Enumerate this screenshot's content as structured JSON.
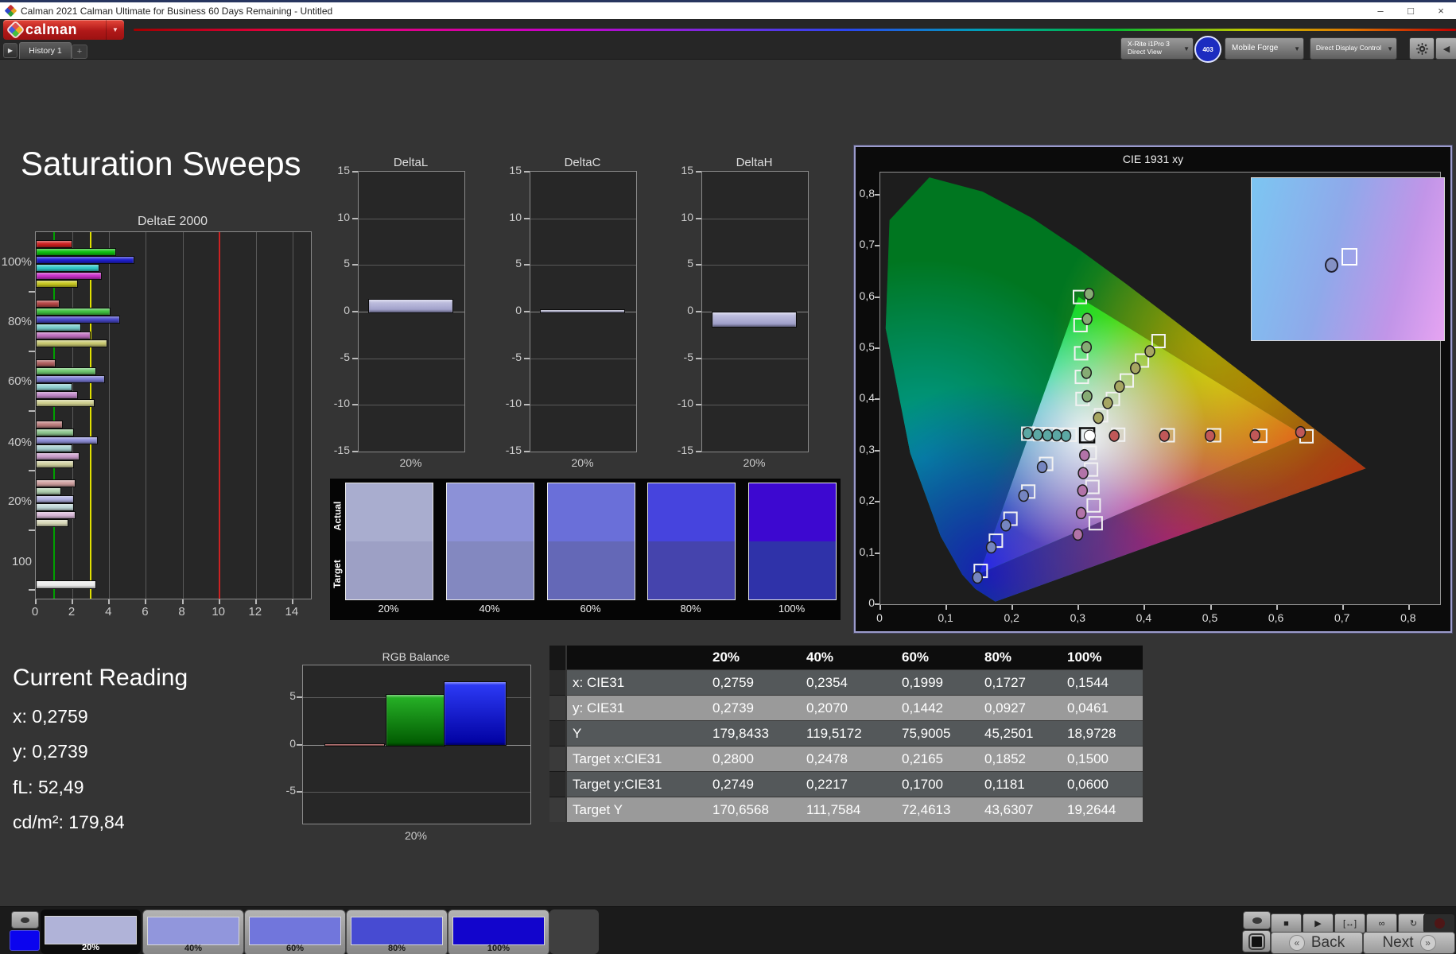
{
  "window": {
    "title": "Calman 2021 Calman Ultimate for Business 60 Days Remaining  - Untitled",
    "minimize": "–",
    "maximize": "□",
    "close": "×"
  },
  "brand": {
    "name": "calman",
    "dropdown_arrow": "▼"
  },
  "nav": {
    "history_tab": "History 1",
    "add_tab": "+",
    "nav_arrow": "▶"
  },
  "devices": {
    "meter": {
      "line1": "X-Rite i1Pro 3",
      "line2": "Direct View",
      "accent": "#2fd42f",
      "badge": "403"
    },
    "source": {
      "label": "Mobile Forge",
      "accent": "#2fd42f"
    },
    "display": {
      "label": "Direct Display Control",
      "accent": "#e6df1a"
    }
  },
  "page_title": "Saturation Sweeps",
  "chart_data": {
    "deltae2000": {
      "type": "bar",
      "title": "DeltaE 2000",
      "orientation": "horizontal",
      "xlim": [
        0,
        15
      ],
      "x_ticks": [
        0,
        2,
        4,
        6,
        8,
        10,
        12,
        14
      ],
      "ref_lines": [
        {
          "value": 1,
          "color": "#00a000"
        },
        {
          "value": 3,
          "color": "#e0e000"
        },
        {
          "value": 10,
          "color": "#cc2222"
        }
      ],
      "series_order": [
        "red",
        "green",
        "blue",
        "cyan",
        "magenta",
        "yellow"
      ],
      "groups": [
        {
          "label": "100%",
          "values": [
            1.9,
            4.3,
            5.3,
            3.4,
            3.5,
            2.2
          ],
          "colors": [
            "#cc2020",
            "#10c010",
            "#2020d0",
            "#30c8c8",
            "#c830c8",
            "#c8c820"
          ]
        },
        {
          "label": "80%",
          "values": [
            1.2,
            4.0,
            4.5,
            2.4,
            2.9,
            3.8
          ],
          "colors": [
            "#b44444",
            "#40c040",
            "#4848c8",
            "#78cccc",
            "#c070c0",
            "#c8c870"
          ]
        },
        {
          "label": "60%",
          "values": [
            1.0,
            3.2,
            3.7,
            1.9,
            2.2,
            3.1
          ],
          "colors": [
            "#b06060",
            "#70c870",
            "#7878d0",
            "#90d0d0",
            "#c088c8",
            "#d0d090"
          ]
        },
        {
          "label": "40%",
          "values": [
            1.4,
            2.0,
            3.3,
            1.9,
            2.3,
            2.0
          ],
          "colors": [
            "#c08080",
            "#90c890",
            "#9090d8",
            "#a8d0d0",
            "#cc9fcc",
            "#d0d0a0"
          ]
        },
        {
          "label": "20%",
          "values": [
            2.1,
            1.3,
            2.0,
            2.0,
            2.1,
            1.7
          ],
          "colors": [
            "#d0a0a0",
            "#b0d0b0",
            "#b0b0e0",
            "#c0d8d8",
            "#d8b8d8",
            "#d8d8b8"
          ]
        }
      ],
      "white_bar": {
        "label": "100",
        "value": 3.2,
        "color": "#ededed"
      }
    },
    "delta_charts": {
      "type": "bar",
      "ylim": [
        -15,
        15
      ],
      "y_ticks": [
        15,
        10,
        5,
        0,
        -5,
        -10,
        -15
      ],
      "xlabel": "20%",
      "bar_color_top": "#c9c9e6",
      "bar_color_bottom": "#9595c2",
      "items": [
        {
          "title": "DeltaL",
          "value": 1.4
        },
        {
          "title": "DeltaC",
          "value": 0.25
        },
        {
          "title": "DeltaH",
          "value": -1.5
        }
      ]
    },
    "swatches": {
      "row_labels": [
        "Actual",
        "Target"
      ],
      "items": [
        {
          "label": "20%",
          "actual": "#a9adcf",
          "target": "#9da0c5"
        },
        {
          "label": "40%",
          "actual": "#8c91d7",
          "target": "#8388c0"
        },
        {
          "label": "60%",
          "actual": "#6a6fd9",
          "target": "#6468b7"
        },
        {
          "label": "80%",
          "actual": "#4644de",
          "target": "#4544ad"
        },
        {
          "label": "100%",
          "actual": "#3d08d0",
          "target": "#2f32a9"
        }
      ]
    },
    "cie": {
      "type": "scatter",
      "title": "CIE 1931 xy",
      "xlim": [
        0,
        0.845
      ],
      "ylim": [
        0,
        0.843
      ],
      "x_ticks": [
        "0",
        "0,1",
        "0,2",
        "0,3",
        "0,4",
        "0,5",
        "0,6",
        "0,7",
        "0,8"
      ],
      "y_ticks": [
        "0",
        "0,1",
        "0,2",
        "0,3",
        "0,4",
        "0,5",
        "0,6",
        "0,7",
        "0,8"
      ],
      "white_point": {
        "target": [
          0.313,
          0.33
        ],
        "measured": [
          0.317,
          0.329
        ]
      },
      "sweeps": [
        {
          "name": "red",
          "dot": "#c05858",
          "targets": [
            [
              0.36,
              0.331
            ],
            [
              0.435,
              0.33
            ],
            [
              0.505,
              0.33
            ],
            [
              0.575,
              0.329
            ],
            [
              0.645,
              0.328
            ]
          ],
          "measured": [
            [
              0.354,
              0.329
            ],
            [
              0.43,
              0.329
            ],
            [
              0.499,
              0.329
            ],
            [
              0.567,
              0.33
            ],
            [
              0.636,
              0.336
            ]
          ]
        },
        {
          "name": "green",
          "dot": "#86ac74",
          "targets": [
            [
              0.306,
              0.401
            ],
            [
              0.305,
              0.444
            ],
            [
              0.304,
              0.49
            ],
            [
              0.303,
              0.545
            ],
            [
              0.302,
              0.6
            ]
          ],
          "measured": [
            [
              0.313,
              0.406
            ],
            [
              0.312,
              0.452
            ],
            [
              0.312,
              0.502
            ],
            [
              0.313,
              0.557
            ],
            [
              0.316,
              0.606
            ]
          ]
        },
        {
          "name": "blue",
          "dot": "#7585c0",
          "targets": [
            [
              0.251,
              0.274
            ],
            [
              0.224,
              0.22
            ],
            [
              0.197,
              0.167
            ],
            [
              0.175,
              0.124
            ],
            [
              0.152,
              0.065
            ]
          ],
          "measured": [
            [
              0.245,
              0.268
            ],
            [
              0.217,
              0.212
            ],
            [
              0.19,
              0.154
            ],
            [
              0.168,
              0.111
            ],
            [
              0.147,
              0.052
            ]
          ]
        },
        {
          "name": "cyan",
          "dot": "#5ca8a4",
          "targets": [
            [
              0.287,
              0.331
            ],
            [
              0.272,
              0.331
            ],
            [
              0.257,
              0.332
            ],
            [
              0.242,
              0.332
            ],
            [
              0.224,
              0.333
            ]
          ],
          "measured": [
            [
              0.281,
              0.329
            ],
            [
              0.267,
              0.33
            ],
            [
              0.253,
              0.33
            ],
            [
              0.238,
              0.331
            ],
            [
              0.223,
              0.334
            ]
          ]
        },
        {
          "name": "magenta",
          "dot": "#b273a8",
          "targets": [
            [
              0.317,
              0.296
            ],
            [
              0.319,
              0.263
            ],
            [
              0.321,
              0.229
            ],
            [
              0.323,
              0.193
            ],
            [
              0.326,
              0.158
            ]
          ],
          "measured": [
            [
              0.309,
              0.291
            ],
            [
              0.307,
              0.256
            ],
            [
              0.306,
              0.222
            ],
            [
              0.304,
              0.178
            ],
            [
              0.299,
              0.136
            ]
          ]
        },
        {
          "name": "yellow",
          "dot": "#a6a662",
          "targets": [
            [
              0.334,
              0.369
            ],
            [
              0.352,
              0.401
            ],
            [
              0.373,
              0.437
            ],
            [
              0.396,
              0.476
            ],
            [
              0.421,
              0.514
            ]
          ],
          "measured": [
            [
              0.33,
              0.364
            ],
            [
              0.344,
              0.393
            ],
            [
              0.362,
              0.425
            ],
            [
              0.386,
              0.461
            ],
            [
              0.408,
              0.494
            ]
          ]
        }
      ]
    },
    "rgb_balance": {
      "type": "bar",
      "title": "RGB Balance",
      "xlabel": "20%",
      "ylim": [
        -8.3,
        8.3
      ],
      "y_ticks": [
        5,
        0,
        -5
      ],
      "series": [
        {
          "name": "red",
          "value": 0.1,
          "color_top": "#b83030",
          "color_bottom": "#701010"
        },
        {
          "name": "green",
          "value": 5.3,
          "color_top": "#28b428",
          "color_bottom": "#005800"
        },
        {
          "name": "blue",
          "value": 6.6,
          "color_top": "#2e3cf8",
          "color_bottom": "#0000a0"
        }
      ]
    },
    "table": {
      "type": "table",
      "columns": [
        "",
        "20%",
        "40%",
        "60%",
        "80%",
        "100%"
      ],
      "rows": [
        {
          "label": "x: CIE31",
          "values": [
            "0,2759",
            "0,2354",
            "0,1999",
            "0,1727",
            "0,1544"
          ]
        },
        {
          "label": "y: CIE31",
          "values": [
            "0,2739",
            "0,2070",
            "0,1442",
            "0,0927",
            "0,0461"
          ]
        },
        {
          "label": "Y",
          "values": [
            "179,8433",
            "119,5172",
            "75,9005",
            "45,2501",
            "18,9728"
          ]
        },
        {
          "label": "Target x:CIE31",
          "values": [
            "0,2800",
            "0,2478",
            "0,2165",
            "0,1852",
            "0,1500"
          ]
        },
        {
          "label": "Target y:CIE31",
          "values": [
            "0,2749",
            "0,2217",
            "0,1700",
            "0,1181",
            "0,0600"
          ]
        },
        {
          "label": "Target Y",
          "values": [
            "170,6568",
            "111,7584",
            "72,4613",
            "43,6307",
            "19,2644"
          ]
        }
      ]
    },
    "current_reading": {
      "title": "Current Reading",
      "lines": [
        {
          "label": "x",
          "value": "0,2759"
        },
        {
          "label": "y",
          "value": "0,2739"
        },
        {
          "label": "fL",
          "value": "52,49"
        },
        {
          "label": "cd/m²",
          "value": "179,84"
        }
      ]
    }
  },
  "bottom": {
    "mini_swatch_color": "#0b04ee",
    "patches": [
      {
        "label": "20%",
        "color": "#b0b3d8",
        "selected": true
      },
      {
        "label": "40%",
        "color": "#9196dc",
        "selected": false
      },
      {
        "label": "60%",
        "color": "#7176dc",
        "selected": false
      },
      {
        "label": "80%",
        "color": "#474bd2",
        "selected": false
      },
      {
        "label": "100%",
        "color": "#1205cc",
        "selected": false
      }
    ],
    "transport": [
      {
        "name": "stop-button",
        "glyph": "■"
      },
      {
        "name": "play-button",
        "glyph": "▶"
      },
      {
        "name": "range-button",
        "glyph": "[↔]"
      },
      {
        "name": "loop-button",
        "glyph": "∞"
      },
      {
        "name": "refresh-button",
        "glyph": "↻"
      }
    ],
    "back": "Back",
    "next": "Next"
  }
}
